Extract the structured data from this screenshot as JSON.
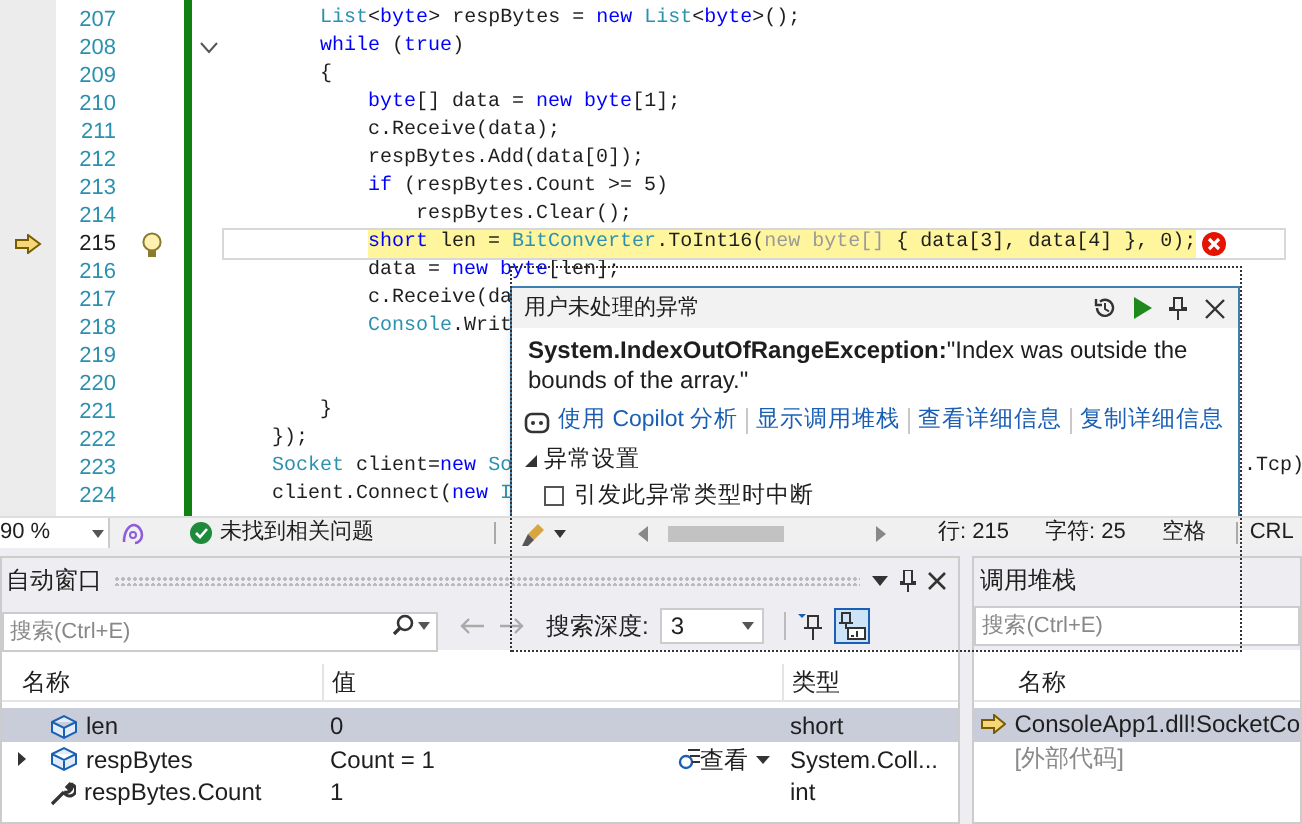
{
  "editor": {
    "lines": [
      {
        "number": "207",
        "current": false,
        "tokens": [
          {
            "text": "        List",
            "kind": "type"
          },
          {
            "text": "<",
            "kind": "plain"
          },
          {
            "text": "byte",
            "kind": "keyword"
          },
          {
            "text": "> respBytes = ",
            "kind": "plain"
          },
          {
            "text": "new ",
            "kind": "keyword"
          },
          {
            "text": "List",
            "kind": "type"
          },
          {
            "text": "<",
            "kind": "plain"
          },
          {
            "text": "byte",
            "kind": "keyword"
          },
          {
            "text": ">();",
            "kind": "plain"
          }
        ]
      },
      {
        "number": "208",
        "current": false,
        "collapsible": true,
        "tokens": [
          {
            "text": "        while",
            "kind": "keyword"
          },
          {
            "text": " (",
            "kind": "plain"
          },
          {
            "text": "true",
            "kind": "keyword"
          },
          {
            "text": ")",
            "kind": "plain"
          }
        ]
      },
      {
        "number": "209",
        "current": false,
        "tokens": [
          {
            "text": "        {",
            "kind": "plain"
          }
        ]
      },
      {
        "number": "210",
        "current": false,
        "tokens": [
          {
            "text": "            byte",
            "kind": "keyword"
          },
          {
            "text": "[] data = ",
            "kind": "plain"
          },
          {
            "text": "new byte",
            "kind": "keyword"
          },
          {
            "text": "[1];",
            "kind": "plain"
          }
        ]
      },
      {
        "number": "211",
        "current": false,
        "tokens": [
          {
            "text": "            c.Receive(data);",
            "kind": "plain"
          }
        ]
      },
      {
        "number": "212",
        "current": false,
        "tokens": [
          {
            "text": "            respBytes.Add(data[0]);",
            "kind": "plain"
          }
        ]
      },
      {
        "number": "213",
        "current": false,
        "tokens": [
          {
            "text": "            if",
            "kind": "keyword"
          },
          {
            "text": " (respBytes.Count >= 5)",
            "kind": "plain"
          }
        ]
      },
      {
        "number": "214",
        "current": false,
        "tokens": [
          {
            "text": "                respBytes.Clear();",
            "kind": "plain"
          }
        ]
      },
      {
        "number": "215",
        "current": true,
        "tokens": [
          {
            "text": "            short",
            "kind": "keyword"
          },
          {
            "text": " len = ",
            "kind": "plain"
          },
          {
            "text": "BitConverter",
            "kind": "type"
          },
          {
            "text": ".ToInt16(",
            "kind": "plain"
          },
          {
            "text": "new byte[]",
            "kind": "hint"
          },
          {
            "text": " { data[3], data[4] }, 0);",
            "kind": "plain"
          }
        ]
      },
      {
        "number": "216",
        "current": false,
        "tokens": [
          {
            "text": "            data = ",
            "kind": "plain"
          },
          {
            "text": "new byte",
            "kind": "keyword"
          },
          {
            "text": "[len];",
            "kind": "plain"
          }
        ]
      },
      {
        "number": "217",
        "current": false,
        "tokens": [
          {
            "text": "            c.Receive(da",
            "kind": "plain"
          }
        ]
      },
      {
        "number": "218",
        "current": false,
        "tokens": [
          {
            "text": "            Console",
            "kind": "type"
          },
          {
            "text": ".Writ",
            "kind": "plain"
          }
        ]
      },
      {
        "number": "219",
        "current": false
      },
      {
        "number": "220",
        "current": false
      },
      {
        "number": "221",
        "current": false,
        "tokens": [
          {
            "text": "        }",
            "kind": "plain"
          }
        ]
      },
      {
        "number": "222",
        "current": false,
        "tokens": [
          {
            "text": "    });",
            "kind": "plain"
          }
        ]
      },
      {
        "number": "223",
        "current": false,
        "tokens": [
          {
            "text": "    Socket",
            "kind": "type"
          },
          {
            "text": " client=",
            "kind": "plain"
          },
          {
            "text": "new",
            "kind": "keyword"
          },
          {
            "text": " So",
            "kind": "type"
          }
        ],
        "right_text": ".Tcp)"
      },
      {
        "number": "224",
        "current": false,
        "tokens": [
          {
            "text": "    client.Connect(",
            "kind": "plain"
          },
          {
            "text": "new",
            "kind": "keyword"
          },
          {
            "text": " I",
            "kind": "type"
          }
        ]
      }
    ]
  },
  "exception_popup": {
    "title": "用户未处理的异常",
    "message": "**System.IndexOutOfRangeException:**\"Index was outside the bounds of the array.\"",
    "links": [
      "使用 Copilot 分析",
      "显示调用堆栈",
      "查看详细信息",
      "复制详细信息"
    ],
    "settings": {
      "label": "异常设置",
      "expanded": true
    },
    "checkbox": {
      "label": "引发此异常类型时中断",
      "checked": false
    }
  },
  "status_bar": {
    "zoom": "90 %",
    "issues": "未找到相关问题",
    "line": "行: 215",
    "column": "字符: 25",
    "spacing": "空格",
    "line_ending": "CRL"
  },
  "autos": {
    "title": "自动窗口",
    "search": {
      "placeholder": "搜索(Ctrl+E)"
    },
    "depth_label": "搜索深度:",
    "depth": "3",
    "columns": [
      "名称",
      "值",
      "类型"
    ],
    "rows": [
      {
        "kind": "local",
        "name": "len",
        "value": "0",
        "type": "short",
        "expandable": false,
        "selected": true
      },
      {
        "kind": "local",
        "name": "respBytes",
        "value": "Count = 1",
        "type": "System.Coll...",
        "expandable": true,
        "selected": false,
        "visualizer": "查看"
      },
      {
        "kind": "property",
        "name": "respBytes.Count",
        "value": "1",
        "type": "int",
        "expandable": false,
        "selected": false
      }
    ]
  },
  "call_stack": {
    "title": "调用堆栈",
    "search": {
      "placeholder": "搜索(Ctrl+E)"
    },
    "column": "名称",
    "rows": [
      {
        "kind": "frame",
        "text": "ConsoleApp1.dll!SocketCo",
        "current": true
      },
      {
        "kind": "external",
        "text": "[外部代码]",
        "current": false
      }
    ]
  }
}
